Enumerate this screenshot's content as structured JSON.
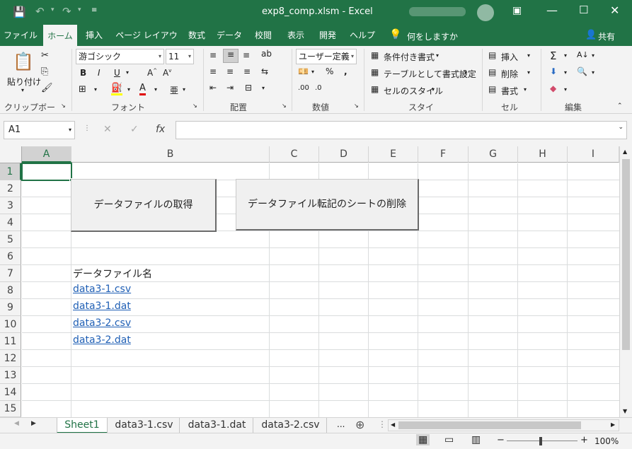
{
  "window": {
    "title": "exp8_comp.xlsm  -  Excel",
    "user_blurred": "",
    "share_label": "共有"
  },
  "ribbon_tabs": [
    "ファイル",
    "ホーム",
    "挿入",
    "ページ レイアウト",
    "数式",
    "データ",
    "校閲",
    "表示",
    "開発",
    "ヘルプ"
  ],
  "tell_me": "何をしますか",
  "clipboard": {
    "paste_label": "貼り付け",
    "group_label": "クリップボード"
  },
  "font": {
    "name": "游ゴシック",
    "size": "11",
    "group_label": "フォント"
  },
  "alignment": {
    "group_label": "配置"
  },
  "number": {
    "format": "ユーザー定義",
    "group_label": "数値"
  },
  "styles": {
    "conditional": "条件付き書式",
    "table": "テーブルとして書式設定",
    "cell": "セルのスタイル",
    "group_label": "スタイル"
  },
  "cells": {
    "insert": "挿入",
    "delete": "削除",
    "format": "書式",
    "group_label": "セル"
  },
  "editing": {
    "group_label": "編集"
  },
  "formula_bar": {
    "name_box": "A1",
    "fx": "fx",
    "value": ""
  },
  "columns": [
    "A",
    "B",
    "C",
    "D",
    "E",
    "F",
    "G",
    "H",
    "I"
  ],
  "rows": [
    "1",
    "2",
    "3",
    "4",
    "5",
    "6",
    "7",
    "8",
    "9",
    "10",
    "11",
    "12",
    "13",
    "14",
    "15"
  ],
  "sheet_buttons": {
    "get_data": "データファイルの取得",
    "delete_sheets": "データファイル転記のシートの削除"
  },
  "cells_content": {
    "header": "データファイル名",
    "files": [
      "data3-1.csv",
      "data3-1.dat",
      "data3-2.csv",
      "data3-2.dat"
    ]
  },
  "sheet_tabs": [
    "Sheet1",
    "data3-1.csv",
    "data3-1.dat",
    "data3-2.csv"
  ],
  "sheet_more": "...",
  "status": {
    "zoom": "100%"
  },
  "colors": {
    "brand": "#217346",
    "link": "#1f5fb5"
  }
}
